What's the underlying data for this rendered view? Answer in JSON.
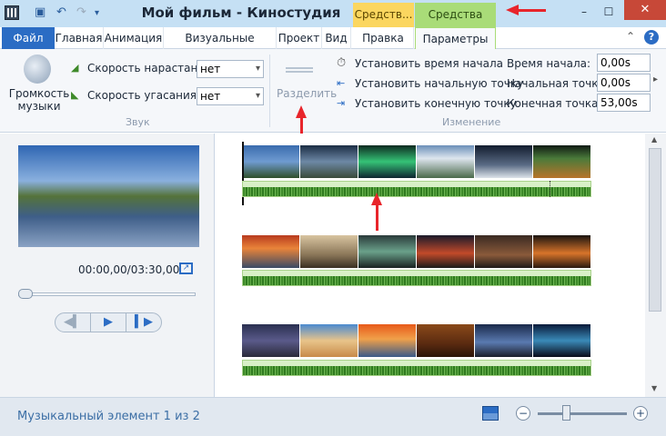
{
  "window": {
    "title": "Мой фильм - Киностудия",
    "context_tab_1": "Средств...",
    "context_tab_2": "Средства дл...",
    "minimize": "–",
    "maximize": "☐",
    "close": "✕"
  },
  "tabs": [
    {
      "label": "Файл"
    },
    {
      "label": "Главная"
    },
    {
      "label": "Анимация"
    },
    {
      "label": "Визуальные эффекты"
    },
    {
      "label": "Проект"
    },
    {
      "label": "Вид"
    },
    {
      "label": "Правка"
    },
    {
      "label": "Параметры"
    }
  ],
  "ribbon": {
    "volume_label": "Громкость музыки",
    "fade_in_label": "Скорость нарастания:",
    "fade_in_value": "нет",
    "fade_out_label": "Скорость угасания:",
    "fade_out_value": "нет",
    "group_sound": "Звук",
    "split_label": "Разделить",
    "set_start_time": "Установить время начала",
    "set_start_point": "Установить начальную точку",
    "set_end_point": "Установить конечную точку",
    "start_time_label": "Время начала:",
    "start_time_value": "0,00s",
    "start_point_label": "Начальная точка:",
    "start_point_value": "0,00s",
    "end_point_label": "Конечная точка:",
    "end_point_value": "53,00s",
    "group_edit": "Изменение"
  },
  "player": {
    "time": "00:00,00/03:30,00"
  },
  "status": {
    "text": "Музыкальный элемент 1 из 2"
  },
  "colors": {
    "accent": "#2b6cc4",
    "context_yellow": "#fbd65f",
    "context_green": "#a9dc78",
    "arrow": "#e8252b"
  }
}
